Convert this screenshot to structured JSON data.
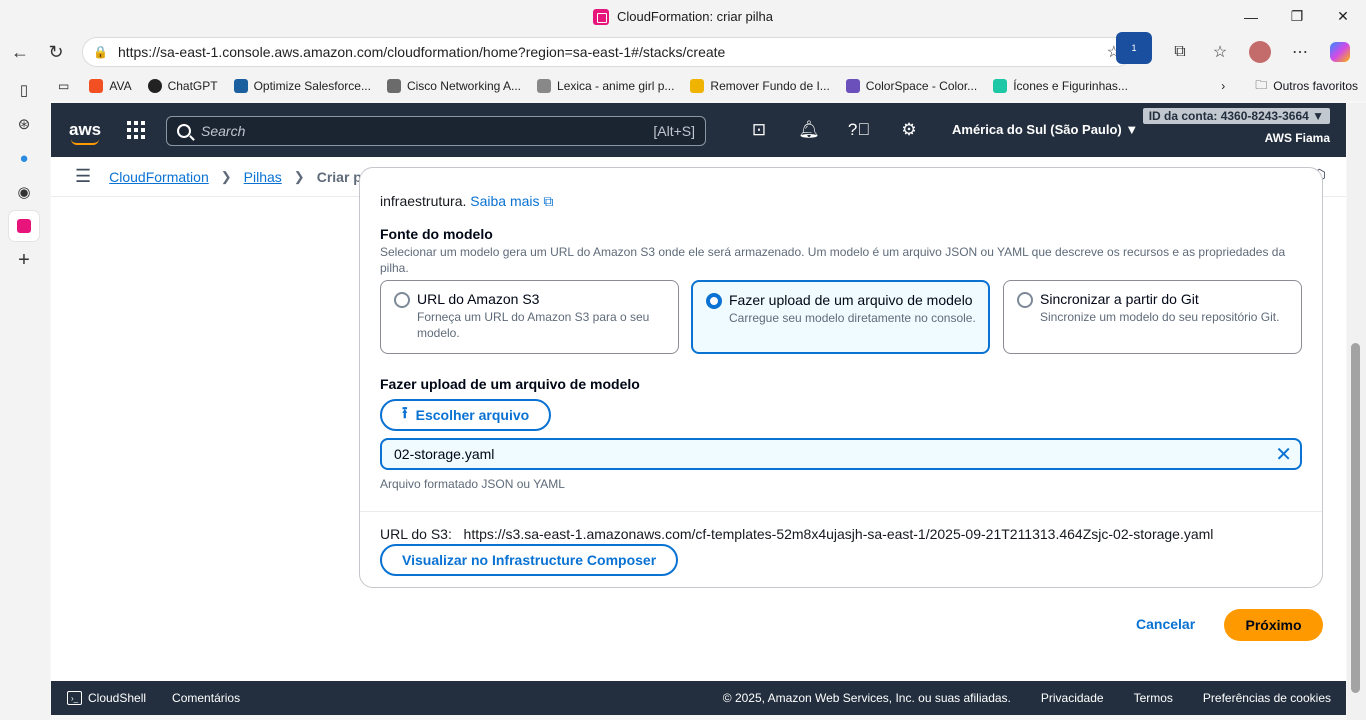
{
  "browser": {
    "tab_title": "CloudFormation: criar pilha",
    "url": "https://sa-east-1.console.aws.amazon.com/cloudformation/home?region=sa-east-1#/stacks/create",
    "bookmarks": [
      {
        "label": "AVA",
        "icon": "ava-icon",
        "color": "#f25022"
      },
      {
        "label": "ChatGPT",
        "icon": "chatgpt-icon",
        "color": "#222222"
      },
      {
        "label": "Optimize Salesforce...",
        "icon": "trailhead-icon",
        "color": "#1b5f9e"
      },
      {
        "label": "Cisco Networking A...",
        "icon": "cisco-icon",
        "color": "#6b6b6b"
      },
      {
        "label": "Lexica - anime girl p...",
        "icon": "lexica-icon",
        "color": "#888888"
      },
      {
        "label": "Remover Fundo de I...",
        "icon": "removebg-icon",
        "color": "#f0b400"
      },
      {
        "label": "ColorSpace - Color...",
        "icon": "colorspace-icon",
        "color": "#6b4fbb"
      },
      {
        "label": "Ícones e Figurinhas...",
        "icon": "flaticon-icon",
        "color": "#1cc7a5"
      }
    ],
    "other_favorites": "Outros favoritos",
    "extension_badge": "1"
  },
  "aws": {
    "search_placeholder": "Search",
    "search_shortcut": "[Alt+S]",
    "region": "América do Sul (São Paulo) ▼",
    "account_id": "ID da conta: 4360-8243-3664 ▼",
    "username": "AWS Fiama"
  },
  "breadcrumb": {
    "items": [
      "CloudFormation",
      "Pilhas"
    ],
    "current": "Criar pilha"
  },
  "form": {
    "intro_text": "infraestrutura.",
    "learn_more": "Saiba mais",
    "template_source_label": "Fonte do modelo",
    "template_source_desc": "Selecionar um modelo gera um URL do Amazon S3 onde ele será armazenado. Um modelo é um arquivo JSON ou YAML que descreve os recursos e as propriedades da pilha.",
    "options": [
      {
        "title": "URL do Amazon S3",
        "desc": "Forneça um URL do Amazon S3 para o seu modelo.",
        "selected": false
      },
      {
        "title": "Fazer upload de um arquivo de modelo",
        "desc": "Carregue seu modelo diretamente no console.",
        "selected": true
      },
      {
        "title": "Sincronizar a partir do Git",
        "desc": "Sincronize um modelo do seu repositório Git.",
        "selected": false
      }
    ],
    "upload_label": "Fazer upload de um arquivo de modelo",
    "choose_file": "Escolher arquivo",
    "file_name": "02-storage.yaml",
    "file_hint": "Arquivo formatado JSON ou YAML",
    "s3_url_label": "URL do S3:",
    "s3_url": "https://s3.sa-east-1.amazonaws.com/cf-templates-52m8x4ujasjh-sa-east-1/2025-09-21T211313.464Zsjc-02-storage.yaml",
    "view_composer": "Visualizar no Infrastructure Composer",
    "cancel": "Cancelar",
    "next": "Próximo"
  },
  "footer": {
    "cloudshell": "CloudShell",
    "feedback": "Comentários",
    "copyright": "© 2025, Amazon Web Services, Inc. ou suas afiliadas.",
    "privacy": "Privacidade",
    "terms": "Termos",
    "cookies": "Preferências de cookies"
  },
  "colors": {
    "aws_nav": "#232f3e",
    "primary_blue": "#0972d3",
    "primary_orange": "#ff9900"
  }
}
